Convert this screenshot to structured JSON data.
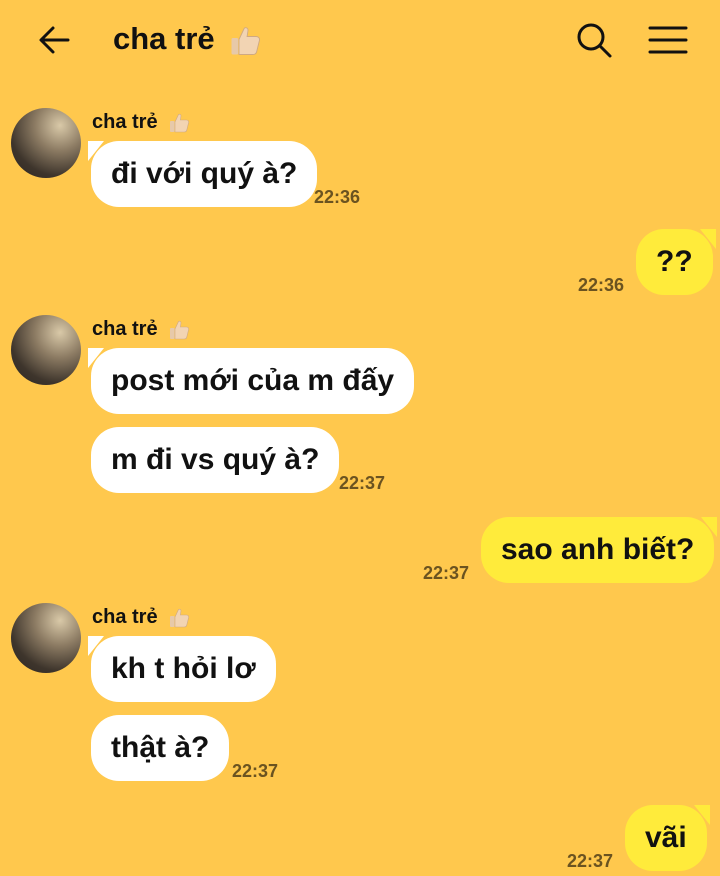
{
  "header": {
    "title": "cha trẻ",
    "title_emoji": "thumbs-up-icon",
    "back_icon": "arrow-left-icon",
    "search_icon": "search-icon",
    "menu_icon": "hamburger-menu-icon"
  },
  "colors": {
    "background": "#FFC84D",
    "incoming_bubble": "#FFFFFF",
    "outgoing_bubble": "#FFEB3B",
    "timestamp": "#6B5320"
  },
  "messages": [
    {
      "direction": "incoming",
      "sender": "cha trẻ",
      "text": "đi với quý à?",
      "time": "22:36"
    },
    {
      "direction": "outgoing",
      "text": "??",
      "time": "22:36"
    },
    {
      "direction": "incoming",
      "sender": "cha trẻ",
      "text": "post mới của m đấy"
    },
    {
      "direction": "incoming",
      "text": "m đi vs quý à?",
      "time": "22:37"
    },
    {
      "direction": "outgoing",
      "text": "sao anh biết?",
      "time": "22:37"
    },
    {
      "direction": "incoming",
      "sender": "cha trẻ",
      "text": "kh t hỏi lơ"
    },
    {
      "direction": "incoming",
      "text": "thật à?",
      "time": "22:37"
    },
    {
      "direction": "outgoing",
      "text": "vãi",
      "time": "22:37"
    }
  ]
}
